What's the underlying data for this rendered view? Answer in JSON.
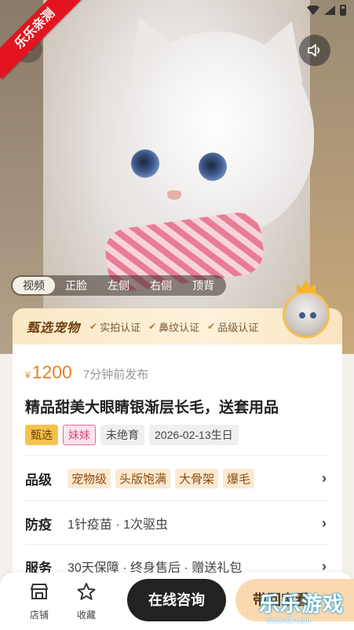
{
  "ribbon": "乐乐亲测",
  "media_tabs": [
    "视频",
    "正脸",
    "左侧",
    "右侧",
    "顶背"
  ],
  "banner": {
    "title": "甄选宠物",
    "certs": [
      "实拍认证",
      "鼻纹认证",
      "品级认证"
    ]
  },
  "listing": {
    "currency": "¥",
    "price": "1200",
    "posted": "7分钟前发布",
    "title": "精品甜美大眼睛银渐层长毛，送套用品",
    "tags": [
      "甄选",
      "妹妹",
      "未绝育",
      "2026-02-13生日"
    ]
  },
  "rows": {
    "quality": {
      "label": "品级",
      "items": [
        "宠物级",
        "头版饱满",
        "大骨架",
        "爆毛"
      ]
    },
    "vaccine": {
      "label": "防疫",
      "text": "1针疫苗 · 1次驱虫"
    },
    "service": {
      "label": "服务",
      "text": "30天保障 · 终身售后 · 赠送礼包"
    }
  },
  "bottom": {
    "shop": "店铺",
    "favorite": "收藏",
    "consult": "在线咨询",
    "visit": "带回家看"
  },
  "watermark": {
    "text": "乐乐游戏",
    "url": "www.6ll.com"
  },
  "colors": {
    "price": "#e3832a",
    "accent_gold": "#f5c24e",
    "dark_button": "#222222",
    "ribbon": "#e3141f"
  }
}
